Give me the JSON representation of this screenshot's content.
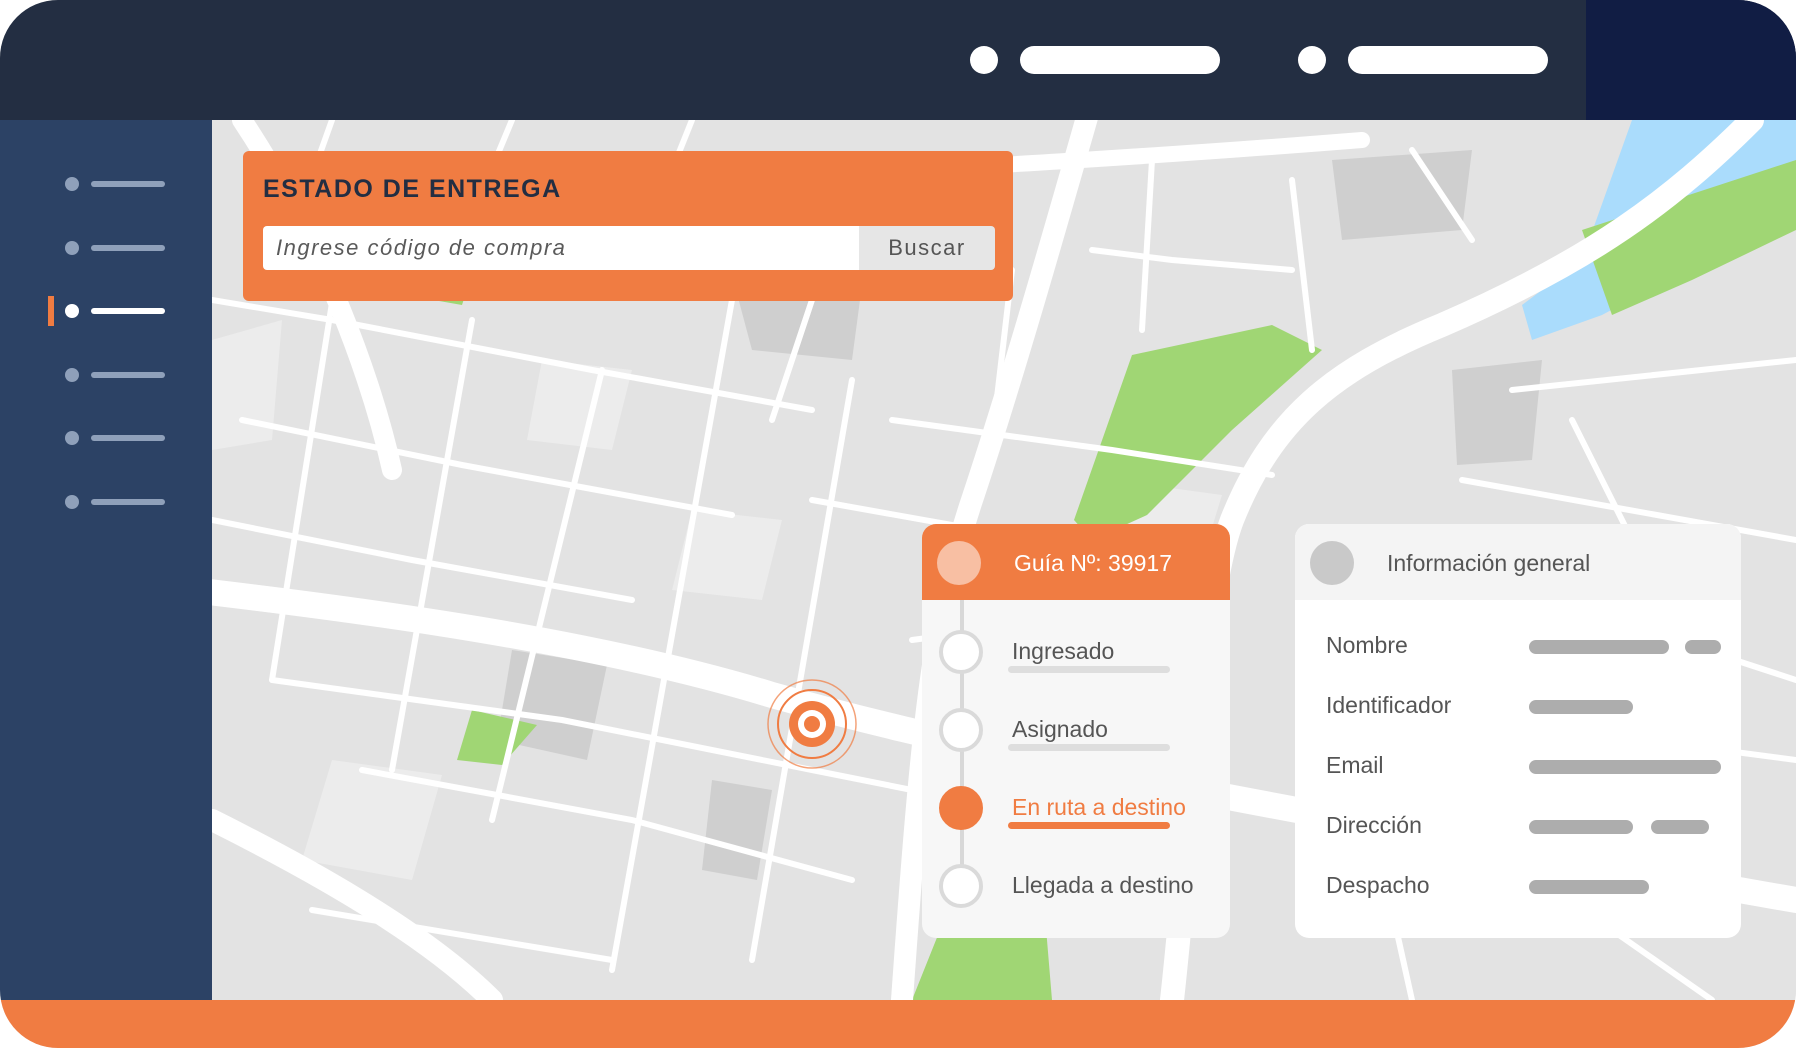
{
  "search": {
    "title": "ESTADO DE ENTREGA",
    "placeholder": "Ingrese código de compra",
    "button_label": "Buscar"
  },
  "guide": {
    "title": "Guía Nº: 39917",
    "steps": [
      {
        "label": "Ingresado",
        "state": "done"
      },
      {
        "label": "Asignado",
        "state": "done"
      },
      {
        "label": "En ruta a destino",
        "state": "current"
      },
      {
        "label": "Llegada a destino",
        "state": "pending"
      }
    ]
  },
  "info": {
    "title": "Información general",
    "rows": [
      {
        "label": "Nombre"
      },
      {
        "label": "Identificador"
      },
      {
        "label": "Email"
      },
      {
        "label": "Dirección"
      },
      {
        "label": "Despacho"
      }
    ]
  },
  "sidebar": {
    "active_index": 2
  },
  "colors": {
    "accent": "#f07c42",
    "topbar": "#232e42",
    "sidebar": "#2c4265",
    "park": "#a0d674",
    "water": "#aadcfc",
    "road": "#ffffff",
    "block": "#e3e3e3"
  },
  "icons": {
    "location": "location-pin-icon"
  }
}
